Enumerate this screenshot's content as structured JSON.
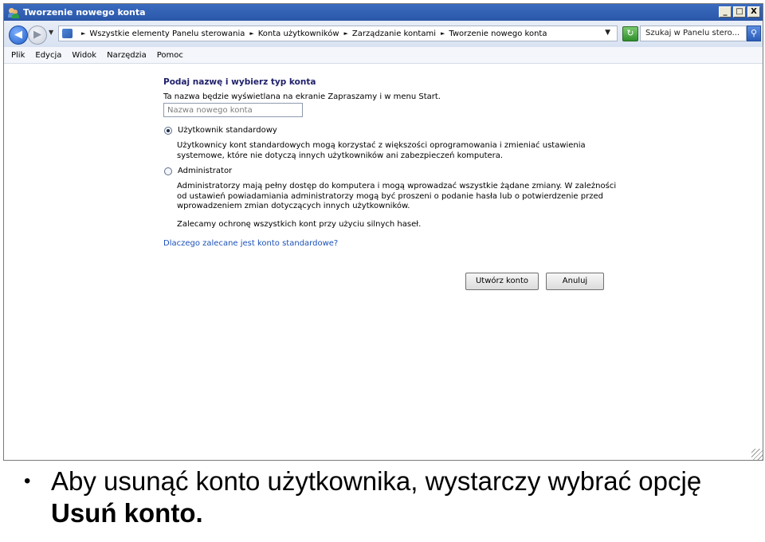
{
  "window": {
    "title": "Tworzenie nowego konta",
    "controls": {
      "minimize": "_",
      "maximize": "□",
      "close": "X"
    }
  },
  "addressbar": {
    "crumbs": [
      "Wszystkie elementy Panelu sterowania",
      "Konta użytkowników",
      "Zarządzanie kontami",
      "Tworzenie nowego konta"
    ],
    "search_placeholder": "Szukaj w Panelu stero..."
  },
  "menu": {
    "items": [
      "Plik",
      "Edycja",
      "Widok",
      "Narzędzia",
      "Pomoc"
    ]
  },
  "content": {
    "title": "Podaj nazwę i wybierz typ konta",
    "hint": "Ta nazwa będzie wyświetlana na ekranie Zapraszamy i w menu Start.",
    "name_placeholder": "Nazwa nowego konta",
    "options": [
      {
        "label": "Użytkownik standardowy",
        "selected": true,
        "description": "Użytkownicy kont standardowych mogą korzystać z większości oprogramowania i zmieniać ustawienia systemowe, które nie dotyczą innych użytkowników ani zabezpieczeń komputera."
      },
      {
        "label": "Administrator",
        "selected": false,
        "description": "Administratorzy mają pełny dostęp do komputera i mogą wprowadzać wszystkie żądane zmiany. W zależności od ustawień powiadamiania administratorzy mogą być proszeni o podanie hasła lub o potwierdzenie przed wprowadzeniem zmian dotyczących innych użytkowników."
      }
    ],
    "recommendation": "Zalecamy ochronę wszystkich kont przy użyciu silnych haseł.",
    "link": "Dlaczego zalecane jest konto standardowe?",
    "create_button": "Utwórz konto",
    "cancel_button": "Anuluj"
  },
  "caption": {
    "bullet": "•",
    "text": "Aby usunąć konto użytkownika, wystarczy wybrać opcję ",
    "bold": "Usuń konto."
  }
}
